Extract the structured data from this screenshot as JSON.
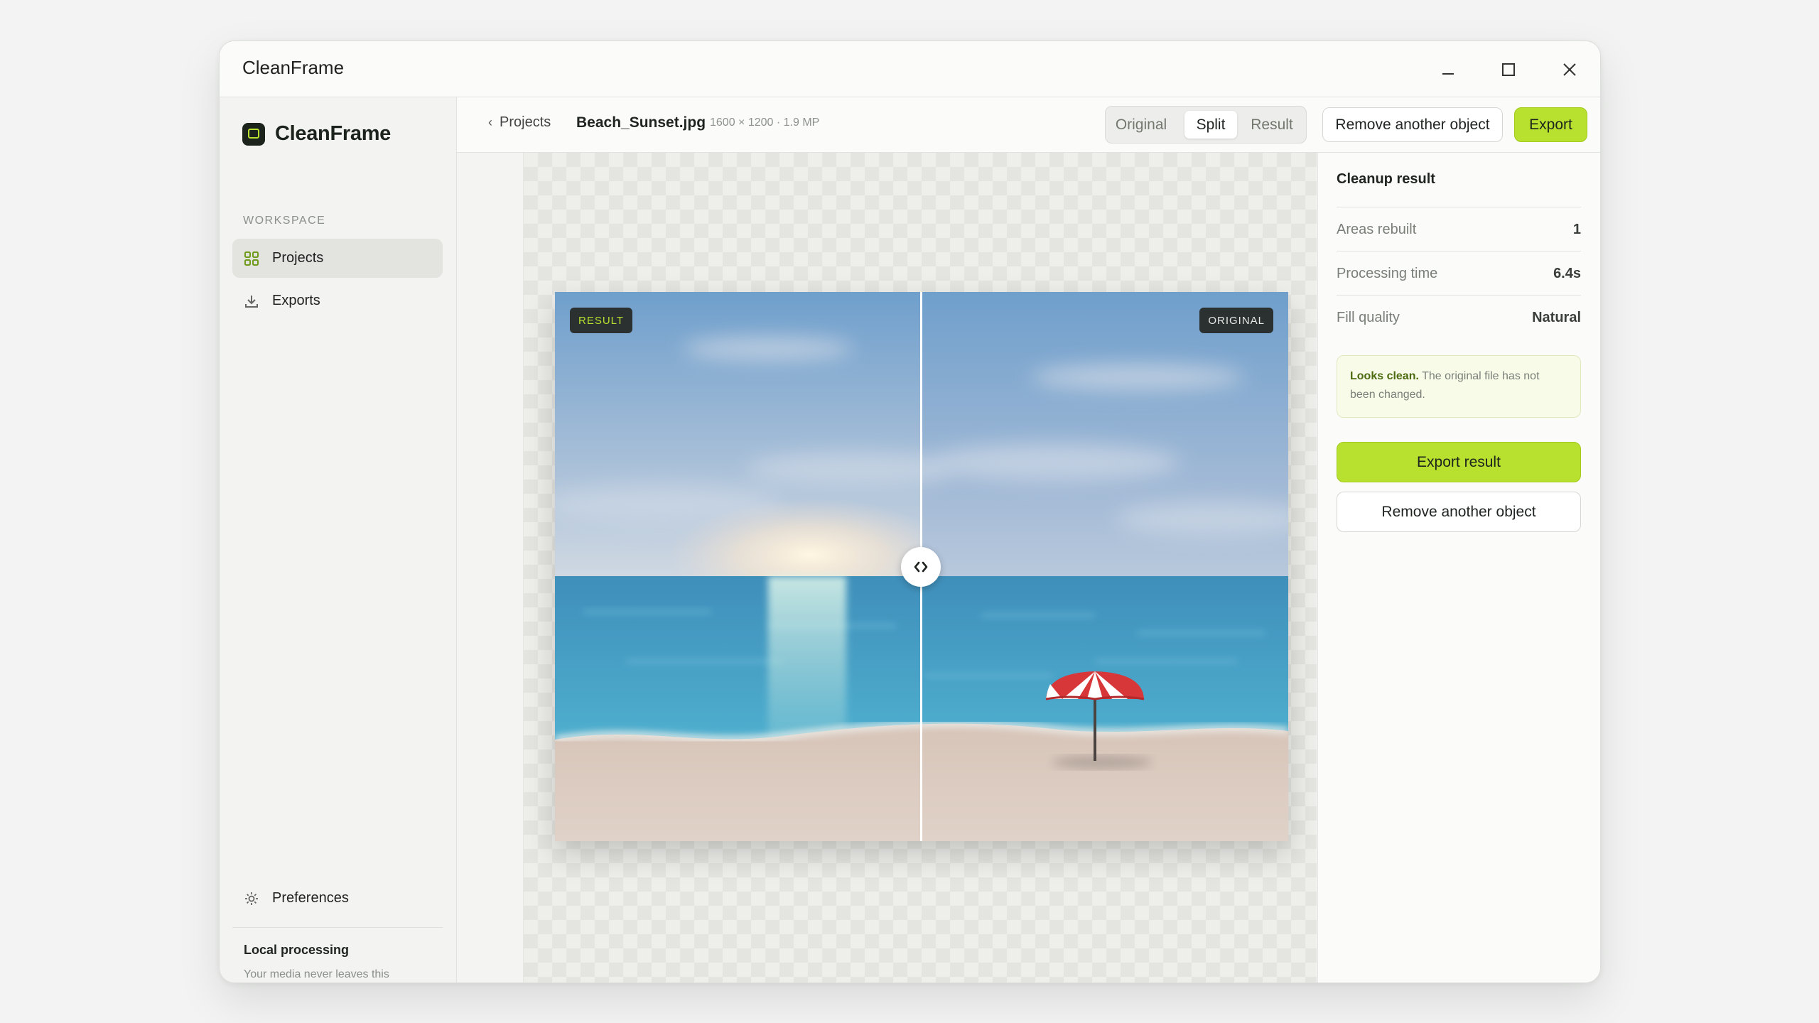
{
  "window": {
    "title": "CleanFrame"
  },
  "sidebar": {
    "logo": "CleanFrame",
    "section_label": "WORKSPACE",
    "items": [
      {
        "label": "Projects",
        "icon": "grid-icon",
        "active": true
      },
      {
        "label": "Exports",
        "icon": "download-icon",
        "active": false
      }
    ],
    "preferences": {
      "label": "Preferences",
      "icon": "gear-icon"
    },
    "local": {
      "title": "Local processing",
      "description": "Your media never leaves this computer."
    }
  },
  "topbar": {
    "breadcrumb": "Projects",
    "filename": "Beach_Sunset.jpg",
    "meta": "1600 × 1200 · 1.9 MP",
    "view_modes": [
      "Original",
      "Split",
      "Result"
    ],
    "active_view": "Split",
    "remove_label": "Remove another object",
    "export_label": "Export"
  },
  "canvas": {
    "result_tag": "RESULT",
    "original_tag": "ORIGINAL",
    "split_position": 0.5
  },
  "panel": {
    "title": "Cleanup result",
    "stats": [
      {
        "label": "Areas rebuilt",
        "value": "1"
      },
      {
        "label": "Processing time",
        "value": "6.4s"
      },
      {
        "label": "Fill quality",
        "value": "Natural"
      }
    ],
    "note_strong": "Looks clean.",
    "note_text": " The original file has not been changed.",
    "export_label": "Export result",
    "remove_label": "Remove another object"
  },
  "colors": {
    "accent": "#b8e02e",
    "logo_dark": "#1c231d"
  }
}
